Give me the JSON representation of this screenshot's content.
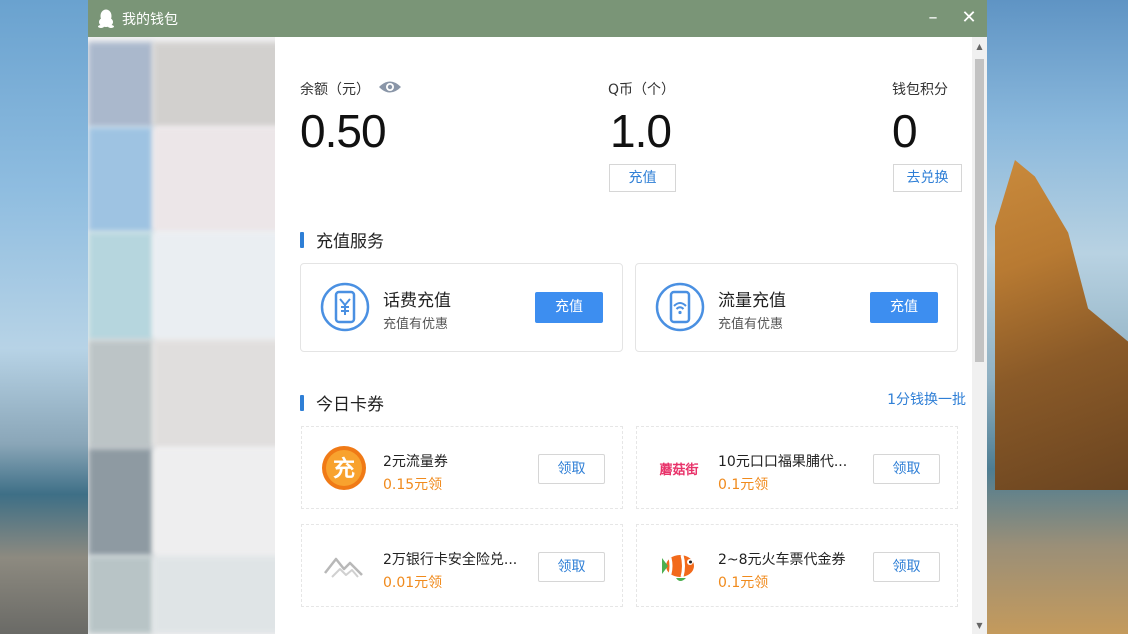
{
  "window": {
    "title": "我的钱包",
    "minimize": "–",
    "close": "✕"
  },
  "stats": {
    "balance": {
      "label": "余额（元）",
      "value": "0.50"
    },
    "qcoin": {
      "label": "Q币（个）",
      "value": "1.0",
      "button": "充值"
    },
    "points": {
      "label": "钱包积分",
      "value": "0",
      "button": "去兑换"
    }
  },
  "recharge": {
    "title": "充值服务",
    "cards": [
      {
        "icon": "yuan-phone-icon",
        "title": "话费充值",
        "subtitle": "充值有优惠",
        "button": "充值"
      },
      {
        "icon": "wifi-phone-icon",
        "title": "流量充值",
        "subtitle": "充值有优惠",
        "button": "充值"
      }
    ]
  },
  "coupons": {
    "title": "今日卡券",
    "swap_link": "1分钱换一批",
    "items": [
      {
        "icon": "recharge-coin-icon",
        "icon_text": "充",
        "title": "2元流量券",
        "price": "0.15元领",
        "button": "领取"
      },
      {
        "icon": "mogujie-logo",
        "icon_text": "蘑菇街",
        "title": "10元口口福果脯代...",
        "price": "0.1元领",
        "button": "领取"
      },
      {
        "icon": "mountain-logo-icon",
        "title": "2万银行卡安全险兑...",
        "price": "0.01元领",
        "button": "领取"
      },
      {
        "icon": "clownfish-icon",
        "title": "2~8元火车票代金券",
        "price": "0.1元领",
        "button": "领取"
      }
    ]
  },
  "colors": {
    "titlebar": "#7a9577",
    "accent": "#2f7fd6",
    "button_blue": "#3d8ef0",
    "price_orange": "#f08a1c"
  }
}
